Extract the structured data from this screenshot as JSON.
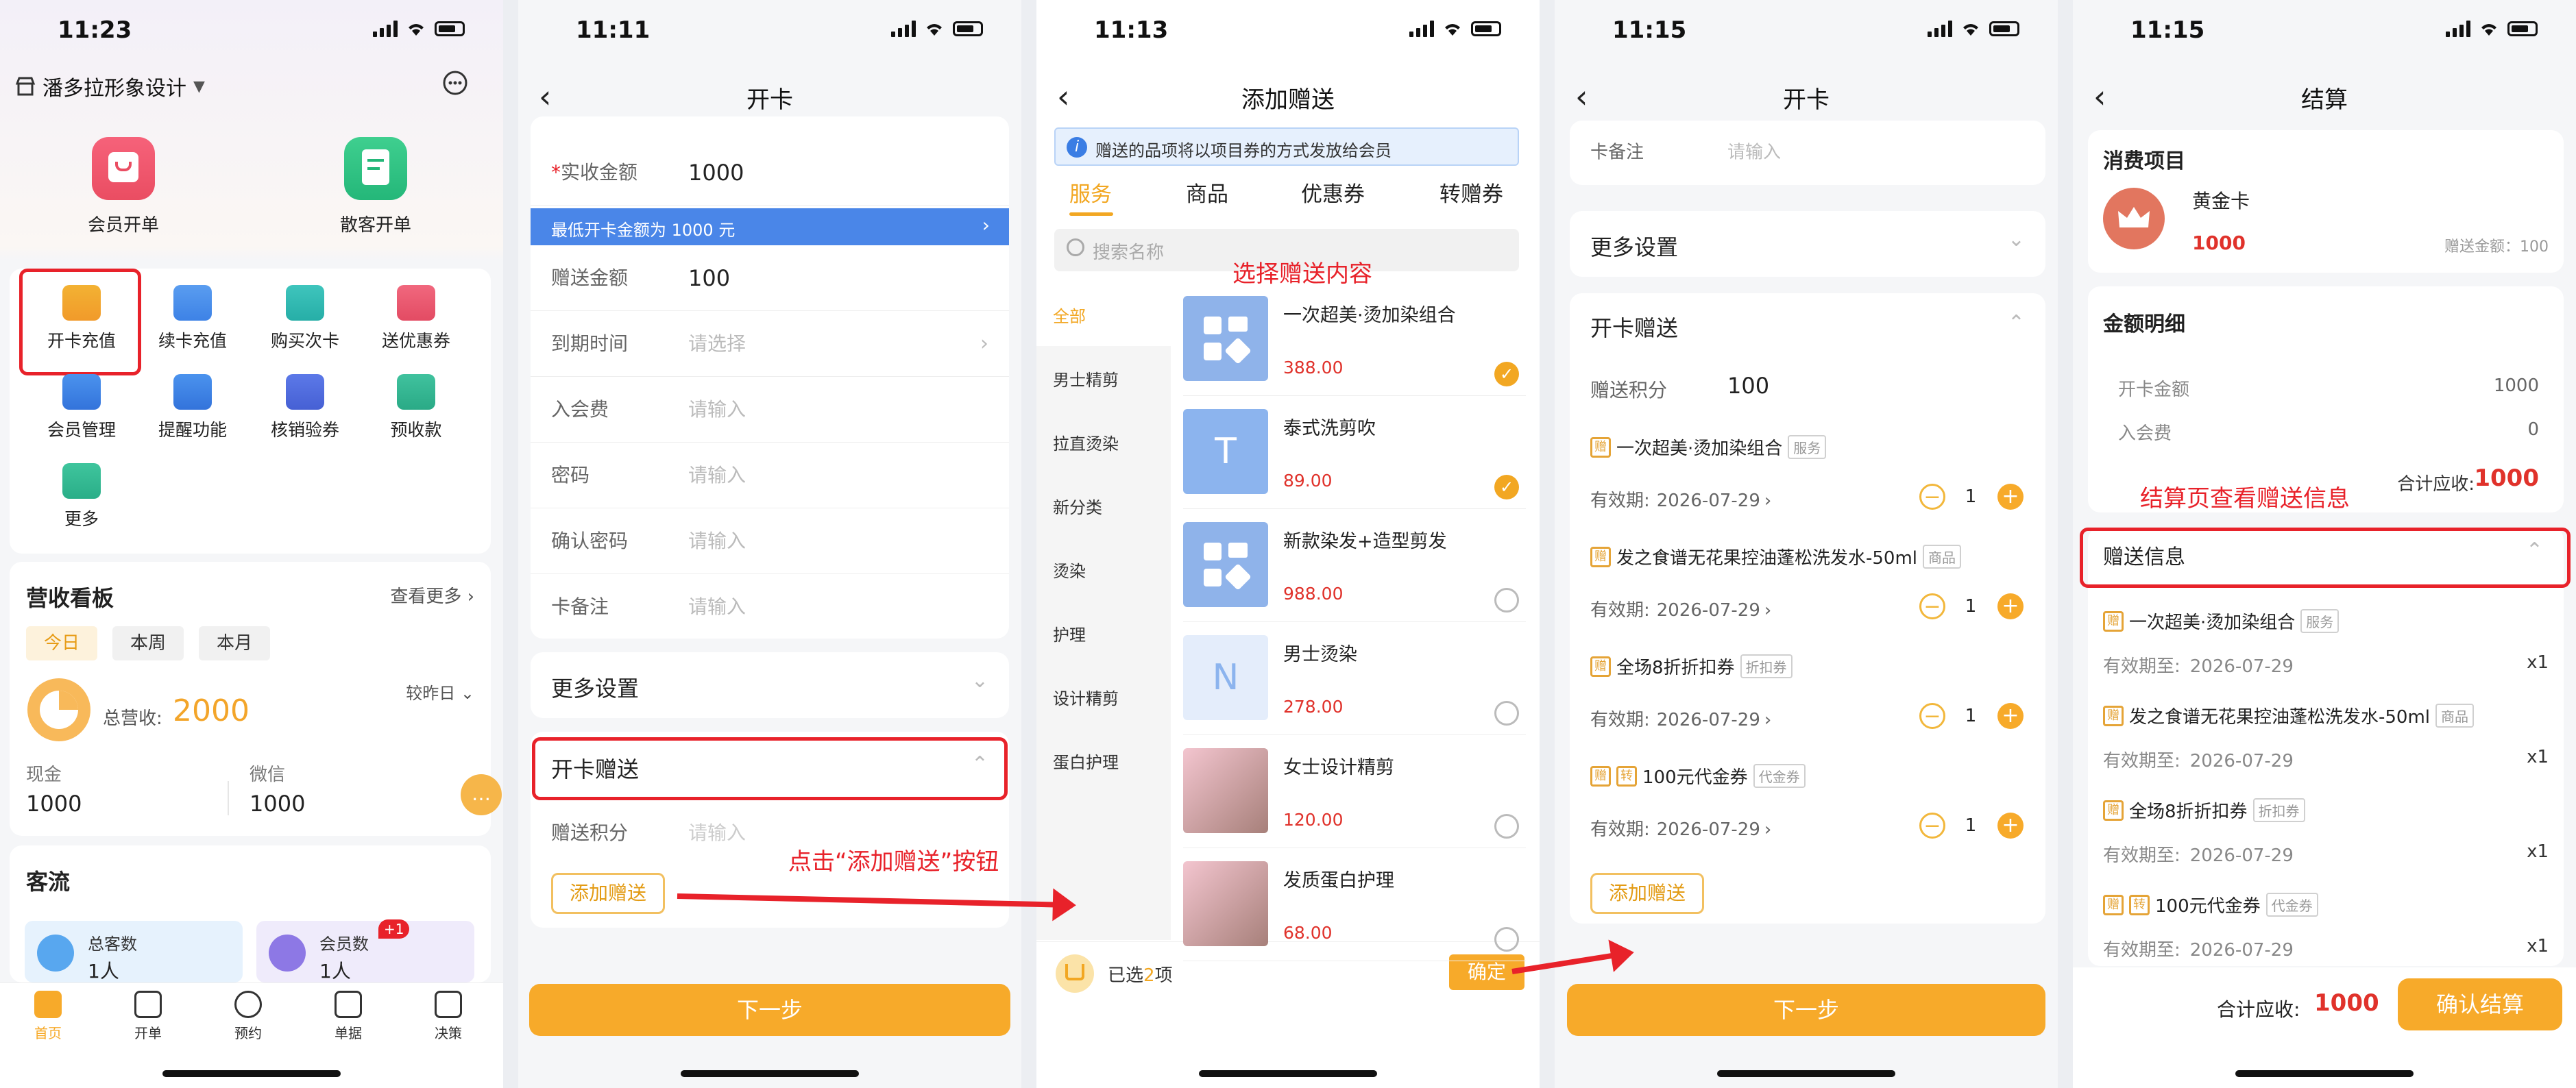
{
  "p1": {
    "time": "11:23",
    "store": "潘多拉形象设计",
    "top_actions": [
      "会员开单",
      "散客开单"
    ],
    "grid": [
      "开卡充值",
      "续卡充值",
      "购买次卡",
      "送优惠券",
      "会员管理",
      "提醒功能",
      "核销验券",
      "预收款",
      "更多"
    ],
    "board_title": "营收看板",
    "board_more": "查看更多",
    "periods": [
      "今日",
      "本周",
      "本月"
    ],
    "compare": "较昨日",
    "total_label": "总营收:",
    "total_value": "2000",
    "cash_label": "现金",
    "cash_value": "1000",
    "wechat_label": "微信",
    "wechat_value": "1000",
    "flow_title": "客流",
    "total_guests": "总客数",
    "guests_value": "1人",
    "members_label": "会员数",
    "members_badge": "+1",
    "members_value": "1人",
    "tabs": [
      "首页",
      "开单",
      "预约",
      "单据",
      "决策"
    ]
  },
  "p2": {
    "time": "11:11",
    "title": "开卡",
    "paid_label": "实收金额",
    "paid_value": "1000",
    "min_note": "最低开卡金额为 1000 元",
    "gift_amount_label": "赠送金额",
    "gift_amount_value": "100",
    "expire_label": "到期时间",
    "expire_ph": "请选择",
    "fee_label": "入会费",
    "input_ph": "请输入",
    "pwd_label": "密码",
    "pwd2_label": "确认密码",
    "remark_label": "卡备注",
    "more_settings": "更多设置",
    "gift_section": "开卡赠送",
    "points_label": "赠送积分",
    "add_gift": "添加赠送",
    "next": "下一步"
  },
  "annot1": "点击“添加赠送”按钮",
  "p3": {
    "time": "11:13",
    "title": "添加赠送",
    "notice": "赠送的品项将以项目券的方式发放给会员",
    "tabs": [
      "服务",
      "商品",
      "优惠券",
      "转赠券"
    ],
    "search_ph": "搜索名称",
    "cats": [
      "全部",
      "男士精剪",
      "拉直烫染",
      "新分类",
      "烫染",
      "护理",
      "设计精剪",
      "蛋白护理"
    ],
    "items": [
      {
        "name": "一次超美·烫加染组合",
        "price": "388.00",
        "checked": true,
        "thumb": "icons"
      },
      {
        "name": "泰式洗剪吹",
        "price": "89.00",
        "checked": true,
        "thumb": "T"
      },
      {
        "name": "新款染发+造型剪发",
        "price": "988.00",
        "checked": false,
        "thumb": "icons"
      },
      {
        "name": "男士烫染",
        "price": "278.00",
        "checked": false,
        "thumb": "N"
      },
      {
        "name": "女士设计精剪",
        "price": "120.00",
        "checked": false,
        "thumb": "photo"
      },
      {
        "name": "发质蛋白护理",
        "price": "68.00",
        "checked": false,
        "thumb": "photo"
      }
    ],
    "selected_prefix": "已选",
    "selected_count": "2",
    "selected_suffix": "项",
    "confirm": "确定"
  },
  "annot2": "选择赠送内容",
  "p4": {
    "time": "11:15",
    "title": "开卡",
    "remark_label": "卡备注",
    "remark_ph": "请输入",
    "more_settings": "更多设置",
    "gift_section": "开卡赠送",
    "points_label": "赠送积分",
    "points_value": "100",
    "valid_label": "有效期:",
    "gifts": [
      {
        "name": "一次超美·烫加染组合",
        "tag": "服务",
        "date": "2026-07-29",
        "qty": "1",
        "transfer": false
      },
      {
        "name": "发之食谱无花果控油蓬松洗发水-50ml",
        "tag": "商品",
        "date": "2026-07-29",
        "qty": "1",
        "transfer": false
      },
      {
        "name": "全场8折折扣券",
        "tag": "折扣券",
        "date": "2026-07-29",
        "qty": "1",
        "transfer": false
      },
      {
        "name": "100元代金券",
        "tag": "代金券",
        "date": "2026-07-29",
        "qty": "1",
        "transfer": true
      }
    ],
    "gift_mark": "赠",
    "transfer_mark": "转",
    "add_gift": "添加赠送",
    "next": "下一步"
  },
  "p5": {
    "time": "11:15",
    "title": "结算",
    "consume_title": "消费项目",
    "card_name": "黄金卡",
    "card_price": "1000",
    "card_gift": "赠送金额：100",
    "detail_title": "金额明细",
    "open_amount_label": "开卡金额",
    "open_amount_value": "1000",
    "fee_label": "入会费",
    "fee_value": "0",
    "due_label": "合计应收:",
    "due_value": "1000",
    "gift_info_title": "赠送信息",
    "valid_label": "有效期至:",
    "gifts": [
      {
        "name": "一次超美·烫加染组合",
        "tag": "服务",
        "date": "2026-07-29",
        "qty": "x1",
        "transfer": false
      },
      {
        "name": "发之食谱无花果控油蓬松洗发水-50ml",
        "tag": "商品",
        "date": "2026-07-29",
        "qty": "x1",
        "transfer": false
      },
      {
        "name": "全场8折折扣券",
        "tag": "折扣券",
        "date": "2026-07-29",
        "qty": "x1",
        "transfer": false
      },
      {
        "name": "100元代金券",
        "tag": "代金券",
        "date": "2026-07-29",
        "qty": "x1",
        "transfer": true
      }
    ],
    "gift_mark": "赠",
    "transfer_mark": "转",
    "bottom_due_label": "合计应收:",
    "bottom_due_value": "1000",
    "confirm": "确认结算"
  },
  "annot3": "结算页查看赠送信息",
  "colors": {
    "accent": "#f7aa2a",
    "annotation": "#e8222a",
    "blue": "#4a86e8",
    "price_red": "#e0322b"
  }
}
